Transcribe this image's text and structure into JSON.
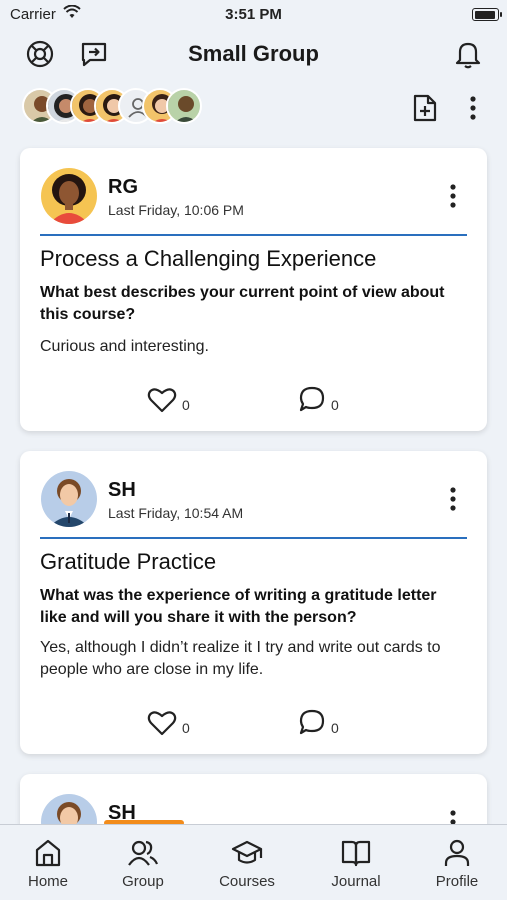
{
  "status": {
    "carrier": "Carrier",
    "time": "3:51 PM"
  },
  "header": {
    "title": "Small Group",
    "icons": [
      "lifebuoy-icon",
      "share-exit-icon",
      "bell-icon"
    ]
  },
  "members": {
    "count": 7,
    "icons": [
      "member-avatar",
      "add-member-icon"
    ]
  },
  "toolbar": {
    "icons": [
      "new-post-icon",
      "more-vertical-icon"
    ]
  },
  "posts": [
    {
      "author": "RG",
      "time": "Last Friday, 10:06 PM",
      "title": "Process a Challenging Experience",
      "question": "What best describes your current point of view about this course?",
      "answer": "Curious and interesting.",
      "likes": "0",
      "comments": "0"
    },
    {
      "author": "SH",
      "time": "Last Friday, 10:54 AM",
      "title": "Gratitude Practice",
      "question": "What was the experience of writing a gratitude letter like and will you share it with the person?",
      "answer": "Yes, although I didn’t realize it I try and write out cards to people who are close in my life.",
      "likes": "0",
      "comments": "0"
    },
    {
      "author": "SH"
    }
  ],
  "tabs": [
    {
      "label": "Home",
      "icon": "home-icon"
    },
    {
      "label": "Group",
      "icon": "group-icon"
    },
    {
      "label": "Courses",
      "icon": "graduation-cap-icon"
    },
    {
      "label": "Journal",
      "icon": "book-icon"
    },
    {
      "label": "Profile",
      "icon": "person-icon"
    }
  ],
  "colors": {
    "accent": "#2a6fbe",
    "background": "#eef2f7",
    "tag": "#f28c1b"
  }
}
